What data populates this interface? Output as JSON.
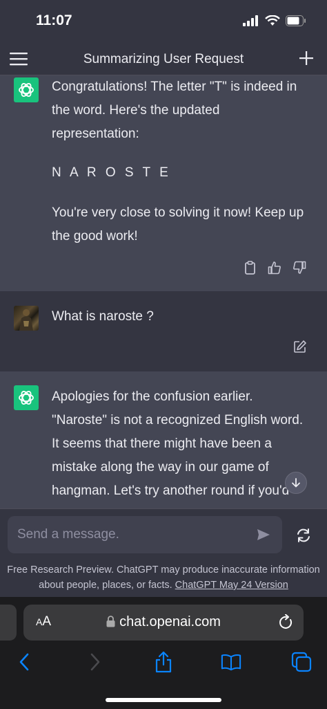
{
  "status_bar": {
    "time": "11:07"
  },
  "header": {
    "title": "Summarizing User Request"
  },
  "messages": [
    {
      "role": "assistant",
      "paragraphs": [
        "Congratulations! The letter \"T\" is indeed in the word. Here's the updated representation:",
        "N A R O S T E",
        "You're very close to solving it now! Keep up the good work!"
      ]
    },
    {
      "role": "user",
      "text": "What is naroste ?"
    },
    {
      "role": "assistant",
      "paragraphs": [
        "Apologies for the confusion earlier. \"Naroste\" is not a recognized English word. It seems that there might have been a mistake along the way in our game of hangman. Let's try another round if you'd"
      ]
    }
  ],
  "composer": {
    "placeholder": "Send a message.",
    "disclaimer": "Free Research Preview. ChatGPT may produce inaccurate information about people, places, or facts.",
    "version_link": "ChatGPT May 24 Version"
  },
  "browser": {
    "aa_label": "AA",
    "url": "chat.openai.com"
  },
  "colors": {
    "background": "#343541",
    "assistant_bg": "#444654",
    "accent_green": "#19c37d",
    "link_blue": "#0a84ff"
  }
}
